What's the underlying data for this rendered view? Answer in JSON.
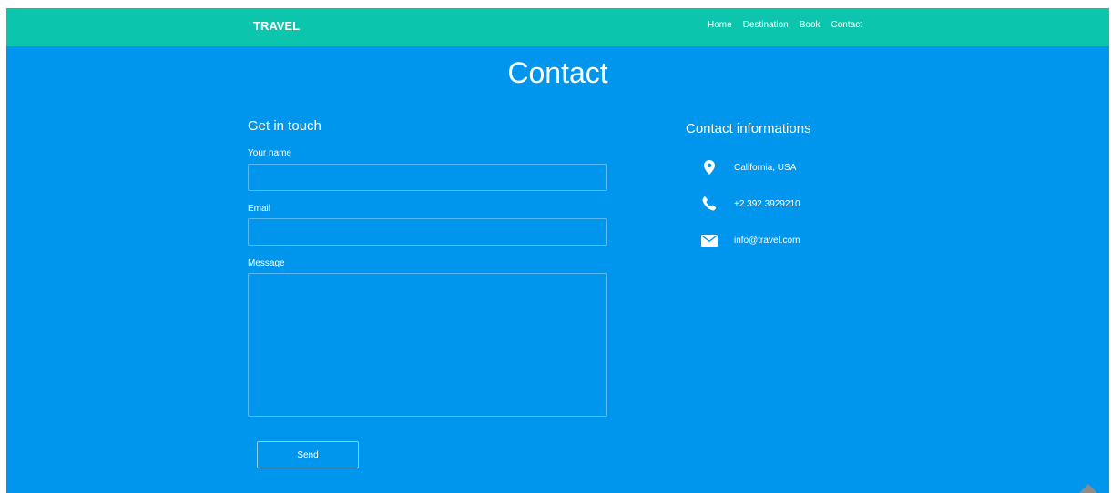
{
  "colors": {
    "navbar": "#0bc6ac",
    "page_background": "#0096ee",
    "text": "#ffffff"
  },
  "navbar": {
    "brand": "TRAVEL",
    "links": [
      "Home",
      "Destination",
      "Book",
      "Contact"
    ]
  },
  "page": {
    "title": "Contact"
  },
  "form": {
    "heading": "Get in touch",
    "name_label": "Your name",
    "name_value": "",
    "email_label": "Email",
    "email_value": "",
    "message_label": "Message",
    "message_value": "",
    "send_label": "Send"
  },
  "contact_info": {
    "heading": "Contact informations",
    "items": [
      {
        "icon": "location-pin-icon",
        "text": "California, USA"
      },
      {
        "icon": "phone-icon",
        "text": "+2 392 3929210"
      },
      {
        "icon": "envelope-icon",
        "text": "info@travel.com"
      }
    ]
  },
  "icons": {
    "scroll_top": "chevron-up-icon"
  }
}
